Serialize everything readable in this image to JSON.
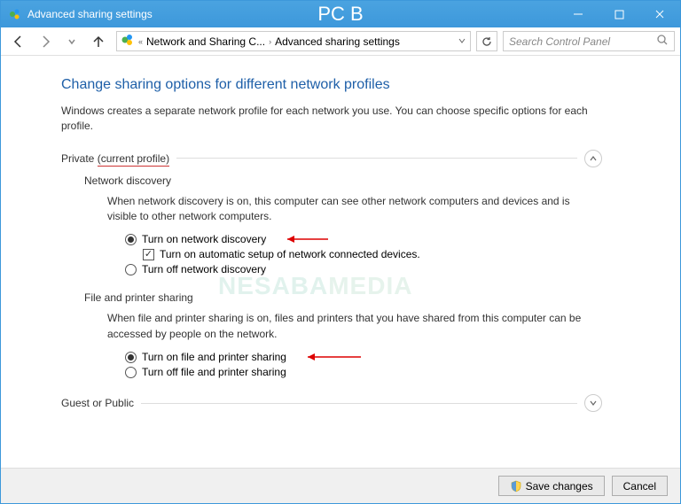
{
  "titlebar": {
    "title": "Advanced sharing settings",
    "center_title": "PC B"
  },
  "breadcrumb": {
    "item1": "Network and Sharing C...",
    "item2": "Advanced sharing settings"
  },
  "search": {
    "placeholder": "Search Control Panel"
  },
  "page": {
    "heading": "Change sharing options for different network profiles",
    "description": "Windows creates a separate network profile for each network you use. You can choose specific options for each profile."
  },
  "sections": {
    "private": {
      "label": "Private",
      "current": "(current profile)",
      "network_discovery": {
        "title": "Network discovery",
        "desc": "When network discovery is on, this computer can see other network computers and devices and is visible to other network computers.",
        "opt_on": "Turn on network discovery",
        "opt_auto": "Turn on automatic setup of network connected devices.",
        "opt_off": "Turn off network discovery"
      },
      "file_printer": {
        "title": "File and printer sharing",
        "desc": "When file and printer sharing is on, files and printers that you have shared from this computer can be accessed by people on the network.",
        "opt_on": "Turn on file and printer sharing",
        "opt_off": "Turn off file and printer sharing"
      }
    },
    "guest": {
      "label": "Guest or Public"
    }
  },
  "footer": {
    "save": "Save changes",
    "cancel": "Cancel"
  },
  "watermark": {
    "part1": "NESABA",
    "part2": "MEDIA"
  }
}
